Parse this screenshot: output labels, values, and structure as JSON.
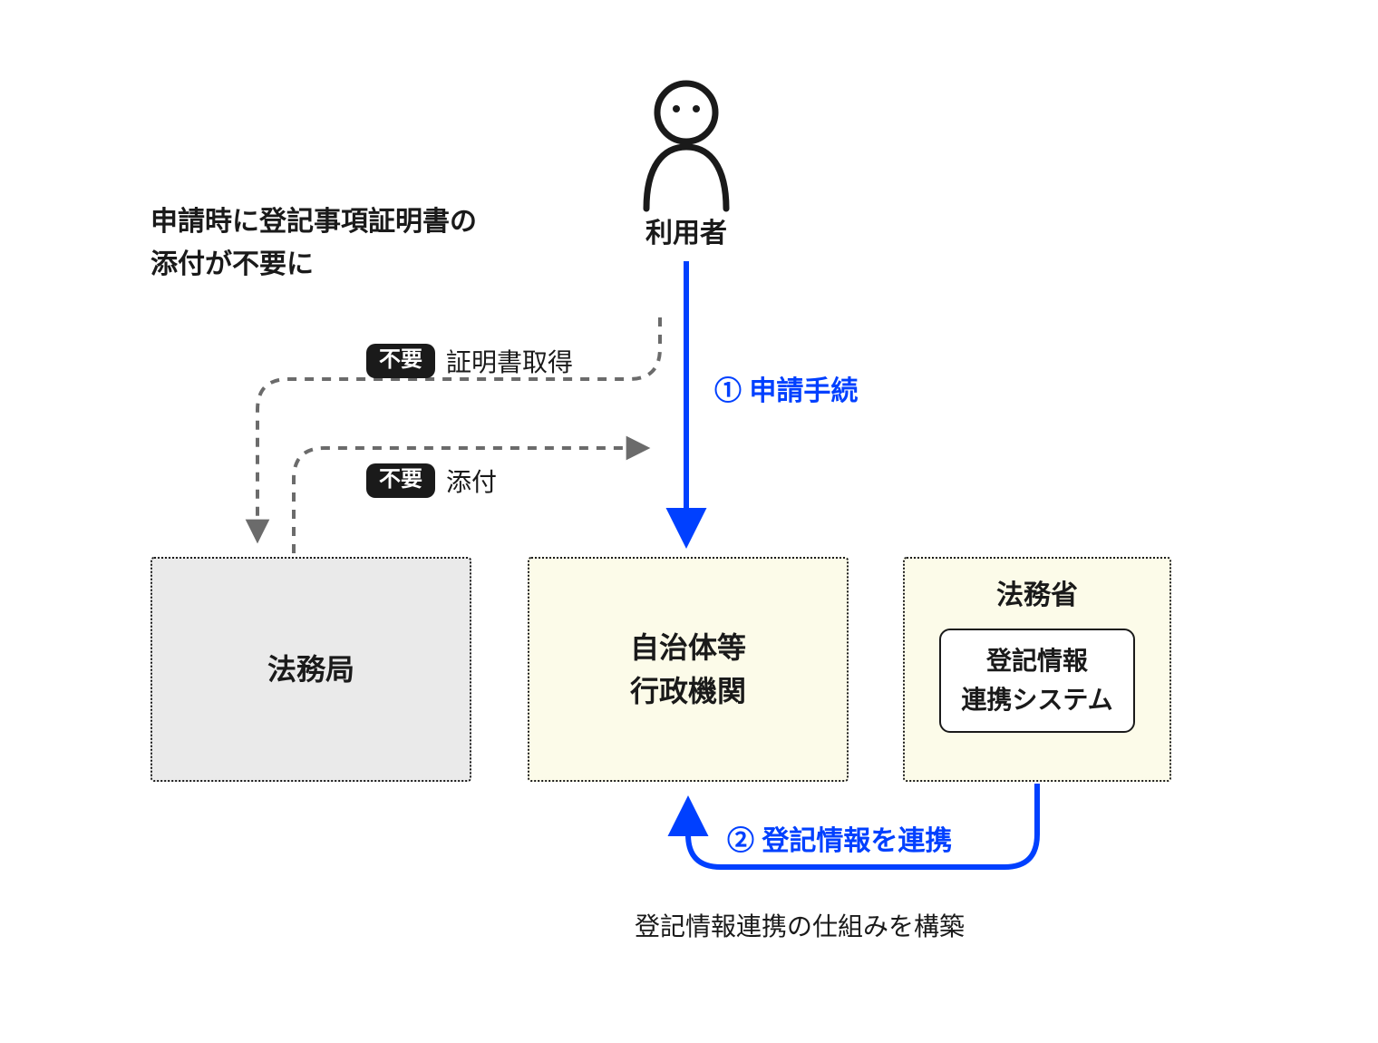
{
  "heading_line1": "申請時に登記事項証明書の",
  "heading_line2": "添付が不要に",
  "user_label": "利用者",
  "step1_label": "① 申請手続",
  "step2_label": "② 登記情報を連携",
  "badge_unnecessary": "不要",
  "flow_get_cert": "証明書取得",
  "flow_attach": "添付",
  "box_legal_bureau": "法務局",
  "box_gov_line1": "自治体等",
  "box_gov_line2": "行政機関",
  "box_moj_title": "法務省",
  "box_moj_sub_line1": "登記情報",
  "box_moj_sub_line2": "連携システム",
  "caption_bottom": "登記情報連携の仕組みを構築",
  "colors": {
    "blue": "#0040ff",
    "grey": "#6b6b6b",
    "dark": "#1a1a1a"
  }
}
